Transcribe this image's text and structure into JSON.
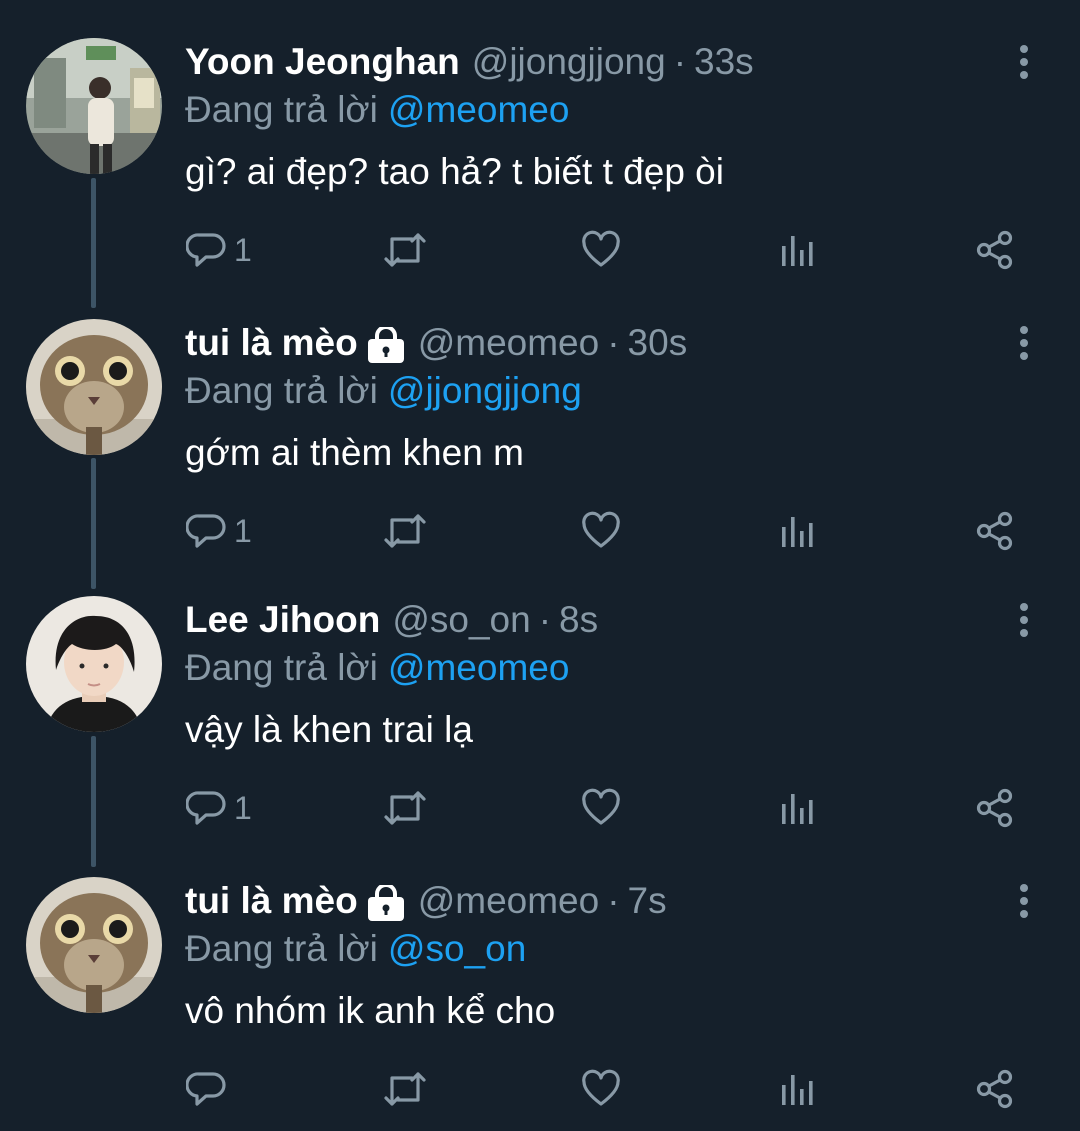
{
  "colors": {
    "background": "#15202b",
    "secondary_text": "#8899a6",
    "mention": "#1da1f2",
    "thread_line": "#3d5466"
  },
  "tweets": [
    {
      "display_name": "Yoon Jeonghan",
      "locked": false,
      "handle": "@jjongjjong",
      "separator": "·",
      "time": "33s",
      "replying_label": "Đang trả lời",
      "replying_to": "@meomeo",
      "text": "gì? ai đẹp? tao hả? t biết t đẹp òi",
      "reply_count": "1",
      "avatar": "photo-person-subway-icon"
    },
    {
      "display_name": "tui là mèo",
      "locked": true,
      "handle": "@meomeo",
      "separator": "·",
      "time": "30s",
      "replying_label": "Đang trả lời",
      "replying_to": "@jjongjjong",
      "text": "gớm ai thèm khen m",
      "reply_count": "1",
      "avatar": "photo-cat-icon"
    },
    {
      "display_name": "Lee Jihoon",
      "locked": false,
      "handle": "@so_on",
      "separator": "·",
      "time": "8s",
      "replying_label": "Đang trả lời",
      "replying_to": "@meomeo",
      "text": "vậy là khen trai lạ",
      "reply_count": "1",
      "avatar": "photo-person-portrait-icon"
    },
    {
      "display_name": "tui là mèo",
      "locked": true,
      "handle": "@meomeo",
      "separator": "·",
      "time": "7s",
      "replying_label": "Đang trả lời",
      "replying_to": "@so_on",
      "text": "vô nhóm ik anh kể cho",
      "reply_count": "",
      "avatar": "photo-cat-icon"
    }
  ],
  "icons": {
    "reply": "reply-icon",
    "retweet": "retweet-icon",
    "like": "like-icon",
    "analytics": "analytics-icon",
    "share": "share-icon",
    "more": "more-vertical-icon",
    "lock": "lock-icon"
  }
}
